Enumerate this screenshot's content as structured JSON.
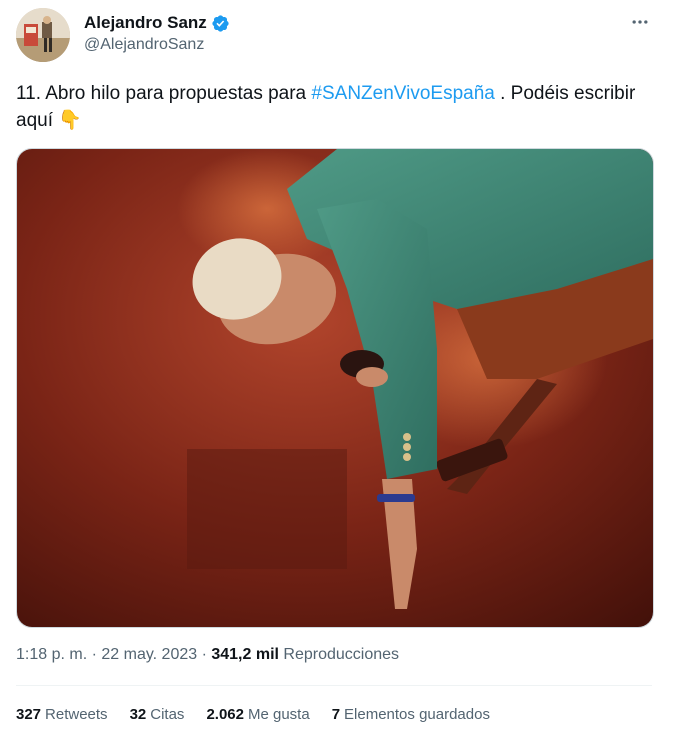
{
  "author": {
    "name": "Alejandro Sanz",
    "handle": "@AlejandroSanz",
    "verified_icon": "verified-badge-icon",
    "verified_color": "#1d9bf0"
  },
  "menu": {
    "icon": "more-options-icon"
  },
  "tweet": {
    "text_before": "11. Abro hilo para propuestas para ",
    "hashtag": "#SANZenVivoEspaña",
    "text_after": " . Podéis escribir aquí ",
    "emoji": "👇"
  },
  "meta": {
    "time": "1:18 p. m.",
    "sep1": " · ",
    "date": "22 may. 2023",
    "sep2": " · ",
    "views_count": "341,2 mil",
    "views_label": " Reproducciones"
  },
  "stats": {
    "retweets_count": "327",
    "retweets_label": "Retweets",
    "quotes_count": "32",
    "quotes_label": "Citas",
    "likes_count": "2.062",
    "likes_label": "Me gusta",
    "bookmarks_count": "7",
    "bookmarks_label": "Elementos guardados"
  },
  "colors": {
    "text": "#0f1419",
    "secondary": "#536471",
    "link": "#1d9bf0",
    "divider": "#eff3f4"
  }
}
